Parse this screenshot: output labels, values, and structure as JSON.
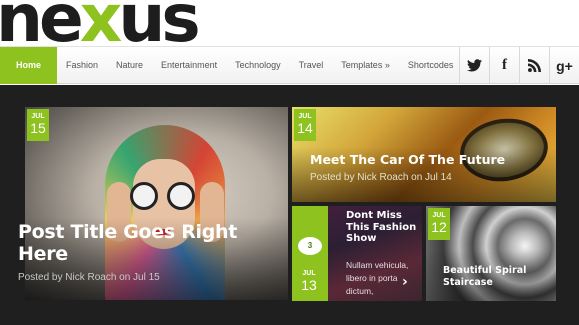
{
  "logo": {
    "prefix": "ne",
    "accent": "x",
    "suffix": "us"
  },
  "nav": {
    "items": [
      "Home",
      "Fashion",
      "Nature",
      "Entertainment",
      "Technology",
      "Travel",
      "Templates »",
      "Shortcodes"
    ],
    "active": "Home"
  },
  "social": [
    {
      "name": "twitter",
      "icon": "twitter-icon"
    },
    {
      "name": "facebook",
      "icon": "facebook-icon",
      "glyph": "f"
    },
    {
      "name": "rss",
      "icon": "rss-icon"
    },
    {
      "name": "google-plus",
      "icon": "google-plus-icon",
      "glyph": "g+"
    }
  ],
  "featured": {
    "main": {
      "month": "JUL",
      "day": "15",
      "title": "Post Title Goes Right Here",
      "meta": "Posted by Nick Roach on Jul 15"
    },
    "car": {
      "month": "JUL",
      "day": "14",
      "title": "Meet The Car Of The Future",
      "meta": "Posted by Nick Roach on Jul 14"
    },
    "fashion": {
      "month": "JUL",
      "day": "13",
      "comments": "3",
      "title": "Dont Miss This Fashion Show",
      "excerpt": "Nullam vehicula, libero in porta dictum,",
      "arrow": "›"
    },
    "spiral": {
      "month": "JUL",
      "day": "12",
      "title": "Beautiful Spiral Staircase"
    }
  },
  "colors": {
    "accent": "#8dc21f",
    "dark_bg": "#1f1f1f",
    "logo": "#1d1d1d"
  }
}
